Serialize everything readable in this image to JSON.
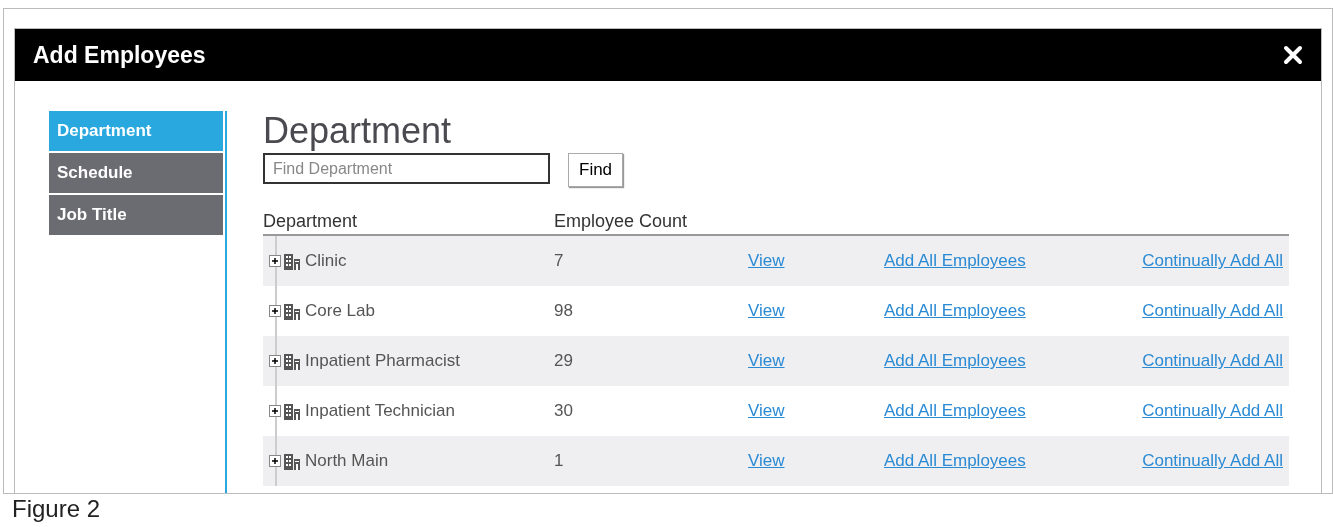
{
  "dialog": {
    "title": "Add Employees"
  },
  "sidebar": {
    "items": [
      {
        "label": "Department",
        "selected": true
      },
      {
        "label": "Schedule",
        "selected": false
      },
      {
        "label": "Job Title",
        "selected": false
      }
    ]
  },
  "main": {
    "heading": "Department",
    "search": {
      "placeholder": "Find Department"
    },
    "find_button": "Find",
    "table": {
      "columns": [
        "Department",
        "Employee Count"
      ],
      "rows": [
        {
          "name": "Clinic",
          "count": "7",
          "links": [
            "View",
            "Add All Employees",
            "Continually Add All"
          ]
        },
        {
          "name": "Core Lab",
          "count": "98",
          "links": [
            "View",
            "Add All Employees",
            "Continually Add All"
          ]
        },
        {
          "name": "Inpatient Pharmacist",
          "count": "29",
          "links": [
            "View",
            "Add All Employees",
            "Continually Add All"
          ]
        },
        {
          "name": "Inpatient Technician",
          "count": "30",
          "links": [
            "View",
            "Add All Employees",
            "Continually Add All"
          ]
        },
        {
          "name": "North Main",
          "count": "1",
          "links": [
            "View",
            "Add All Employees",
            "Continually Add All"
          ]
        }
      ]
    }
  },
  "caption": "Figure 2"
}
